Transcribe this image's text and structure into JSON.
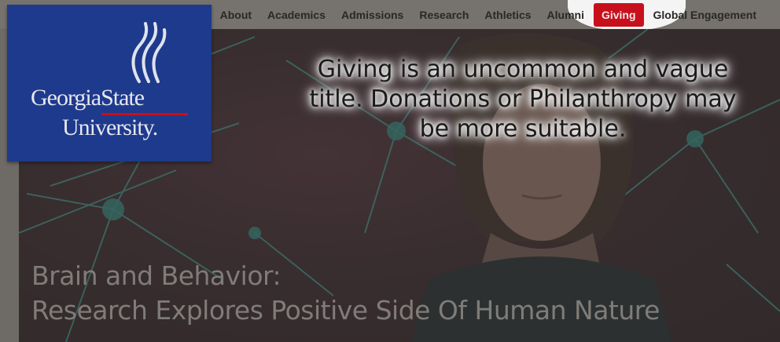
{
  "nav": {
    "items": [
      "About",
      "Academics",
      "Admissions",
      "Research",
      "Athletics",
      "Alumni",
      "Giving",
      "Global Engagement"
    ],
    "active": "Giving"
  },
  "logo": {
    "line1": "GeorgiaState",
    "line2": "University."
  },
  "annotation": {
    "line1": "Giving is an uncommon and vague",
    "line2": "title. Donations  or Philanthropy may",
    "line3": "be more suitable."
  },
  "hero": {
    "headline_line1": "Brain and Behavior:",
    "headline_line2": "Research Explores Positive Side Of Human Nature"
  },
  "colors": {
    "brand_blue": "#1e3a8c",
    "accent_red": "#c8101c"
  }
}
